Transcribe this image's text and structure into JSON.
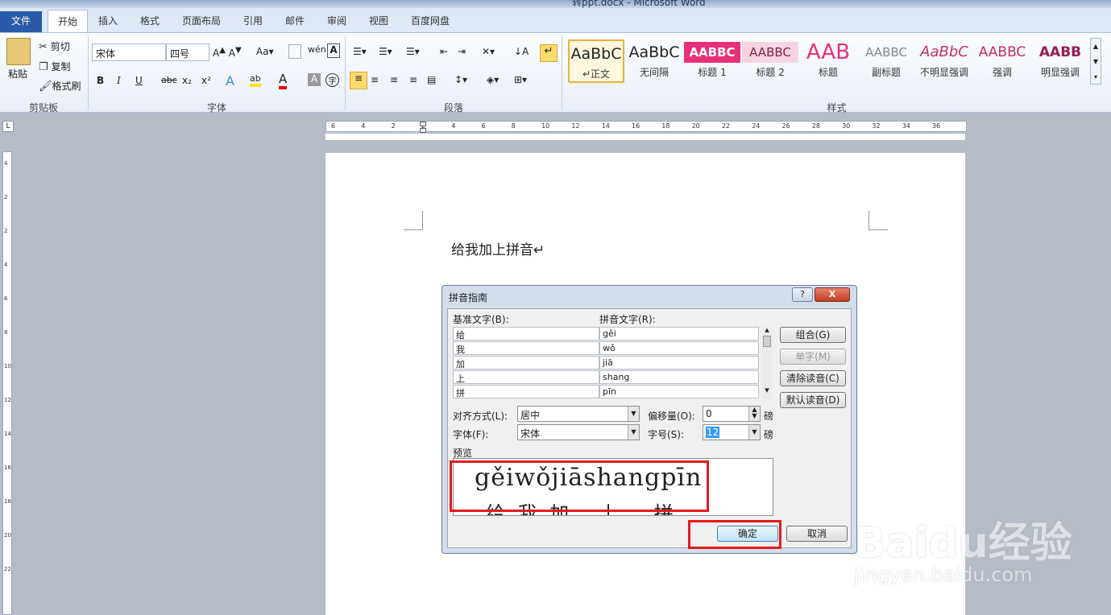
{
  "app": {
    "title": "转ppt.docx - Microsoft Word"
  },
  "tabs": [
    "文件",
    "开始",
    "插入",
    "格式",
    "页面布局",
    "引用",
    "邮件",
    "审阅",
    "视图",
    "百度网盘"
  ],
  "clipboard": {
    "paste": "粘贴",
    "cut": "剪切",
    "copy": "复制",
    "format_painter": "格式刷",
    "group": "剪贴板"
  },
  "font": {
    "name": "宋体",
    "size": "四号",
    "group": "字体",
    "bold": "B",
    "italic": "I",
    "underline": "U",
    "strike": "abc"
  },
  "paragraph": {
    "group": "段落"
  },
  "styles": {
    "group": "样式",
    "items": [
      {
        "preview": "AaBbC",
        "name": "↵正文"
      },
      {
        "preview": "AaBbC",
        "name": "无间隔"
      },
      {
        "preview": "AABBC",
        "name": "标题 1"
      },
      {
        "preview": "AABBC",
        "name": "标题 2"
      },
      {
        "preview": "AAB",
        "name": "标题"
      },
      {
        "preview": "AABBC",
        "name": "副标题"
      },
      {
        "preview": "AaBbC",
        "name": "不明显强调"
      },
      {
        "preview": "AABBC",
        "name": "强调"
      },
      {
        "preview": "AABB",
        "name": "明显强调"
      }
    ]
  },
  "ruler_h": [
    "6",
    "4",
    "2",
    "2",
    "4",
    "6",
    "8",
    "10",
    "12",
    "14",
    "16",
    "18",
    "20",
    "22",
    "24",
    "26",
    "28",
    "30",
    "32",
    "34",
    "36"
  ],
  "document": {
    "text": "给我加上拼音↵"
  },
  "dialog": {
    "title": "拼音指南",
    "base_label": "基准文字(B):",
    "pinyin_label": "拼音文字(R):",
    "rows": [
      {
        "base": "给",
        "pinyin": "gěi"
      },
      {
        "base": "我",
        "pinyin": "wǒ"
      },
      {
        "base": "加",
        "pinyin": "jiā"
      },
      {
        "base": "上",
        "pinyin": "shang"
      },
      {
        "base": "拼",
        "pinyin": "pīn"
      }
    ],
    "btn_group": "组合(G)",
    "btn_single": "单字(M)",
    "btn_clear": "清除读音(C)",
    "btn_default": "默认读音(D)",
    "align_label": "对齐方式(L):",
    "align_value": "居中",
    "offset_label": "偏移量(O):",
    "offset_value": "0",
    "offset_unit": "磅",
    "font_label": "字体(F):",
    "font_value": "宋体",
    "size_label": "字号(S):",
    "size_value": "12",
    "size_unit": "磅",
    "preview_label": "预览",
    "preview_pinyin": "gěiwǒjiāshangpīn",
    "preview_chars": [
      "给",
      "我",
      "加",
      "上",
      "拼"
    ],
    "ok": "确定",
    "cancel": "取消",
    "help": "?",
    "close": "X"
  },
  "watermark": {
    "brand": "Baidu经验",
    "url": "jingyan.baidu.com"
  }
}
